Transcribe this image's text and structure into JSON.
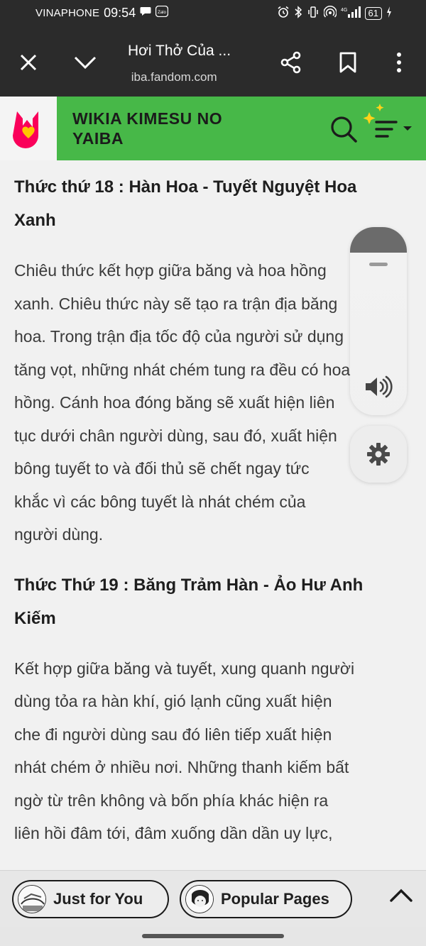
{
  "status_bar": {
    "carrier": "VINAPHONE",
    "time": "09:54",
    "zalo_label": "Zalo",
    "network": "4G",
    "battery": "61"
  },
  "browser": {
    "title": "Hơi Thở Của ...",
    "url": " iba.fandom.com"
  },
  "wiki": {
    "name_line1": "WIKIA KIMESU NO",
    "name_line2": "YAIBA"
  },
  "article": {
    "heading1_line1": "Thức thứ 18 : Hàn Hoa - Tuyết Nguyệt Hoa",
    "heading1_line2": "Xanh",
    "para1": [
      "Chiêu thức kết hợp giữa băng và hoa hồng",
      "xanh. Chiêu thức này sẽ tạo ra trận địa băng",
      "hoa. Trong trận địa tốc độ của người sử dụng",
      "tăng vọt, những nhát chém tung ra đều có hoa",
      "hồng. Cánh hoa đóng băng sẽ xuất hiện liên",
      "tục dưới chân người dùng, sau đó, xuất hiện",
      "bông tuyết to và đối thủ sẽ chết ngay tức",
      "khắc vì các bông tuyết là nhát chém của",
      "người dùng."
    ],
    "heading2_line1": "Thức Thứ 19 : Băng Trảm Hàn - Ảo Hư Anh",
    "heading2_line2": "Kiếm",
    "para2": [
      "Kết hợp giữa băng và tuyết, xung quanh người",
      "dùng tỏa ra hàn khí, gió lạnh cũng xuất hiện",
      "che đi người dùng sau đó liên tiếp xuất hiện",
      "nhát chém ở nhiều nơi. Những thanh kiếm bất",
      "ngờ từ trên không và bốn phía khác hiện ra",
      "liên hồi đâm tới, đâm xuống dần dần uy lực,"
    ]
  },
  "bottom_bar": {
    "just_for_you": "Just for You",
    "popular_pages": "Popular Pages"
  },
  "colors": {
    "wiki_green": "#47b848",
    "fandom_pink": "#fa005a",
    "fandom_yellow": "#ffc500",
    "dark_bar": "#2b2b2b"
  }
}
